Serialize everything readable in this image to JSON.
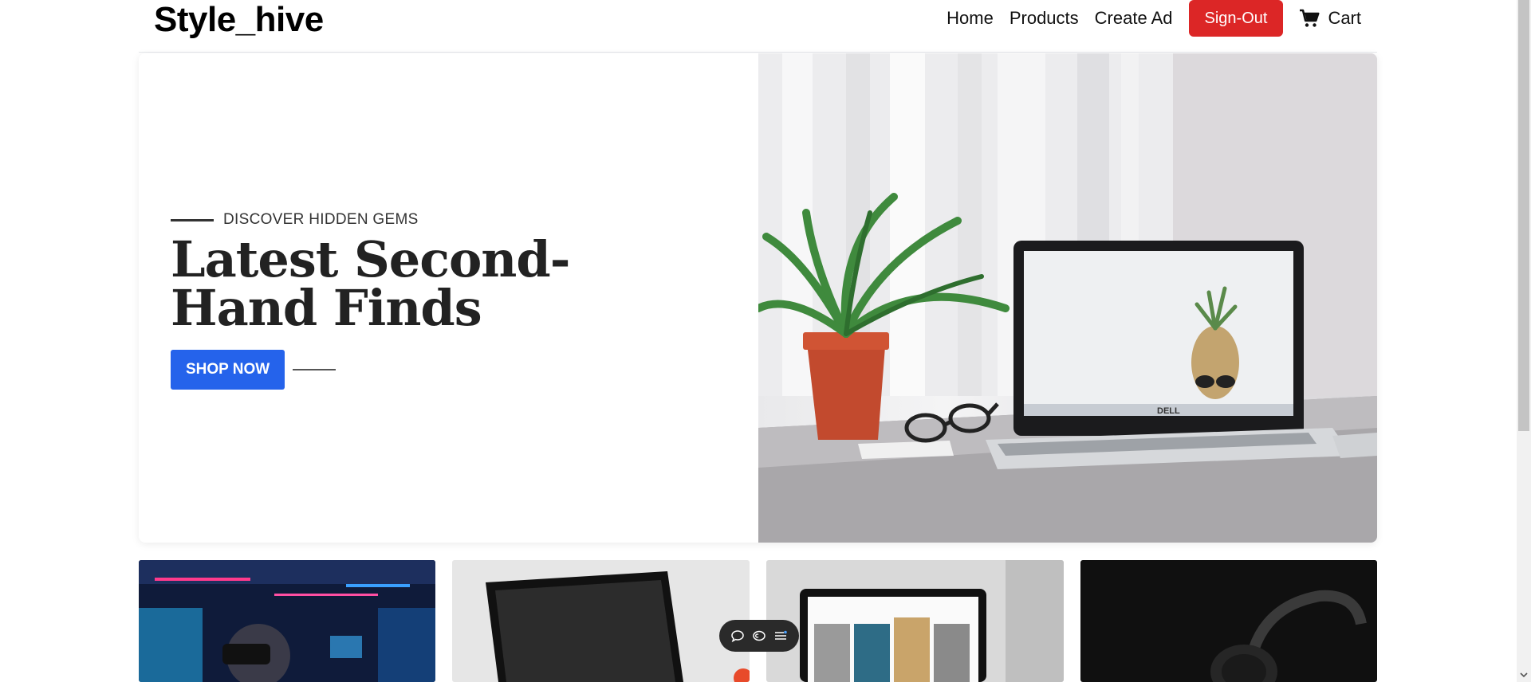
{
  "header": {
    "brand": "Style_hive",
    "nav": {
      "home": "Home",
      "products": "Products",
      "create_ad": "Create Ad",
      "sign_out": "Sign-Out",
      "cart": "Cart"
    }
  },
  "hero": {
    "eyebrow": "DISCOVER HIDDEN GEMS",
    "title": "Latest Second-Hand Finds",
    "cta": "SHOP NOW",
    "laptop_brand": "DELL"
  },
  "colors": {
    "sign_out_bg": "#dc2626",
    "cta_bg": "#2563eb"
  },
  "product_cards": [
    {
      "name": "vr-gaming-card"
    },
    {
      "name": "tablet-card"
    },
    {
      "name": "art-tablet-card"
    },
    {
      "name": "headphones-card"
    }
  ],
  "float_bar": {
    "icons": [
      "chat-icon",
      "caption-icon",
      "list-icon"
    ]
  }
}
